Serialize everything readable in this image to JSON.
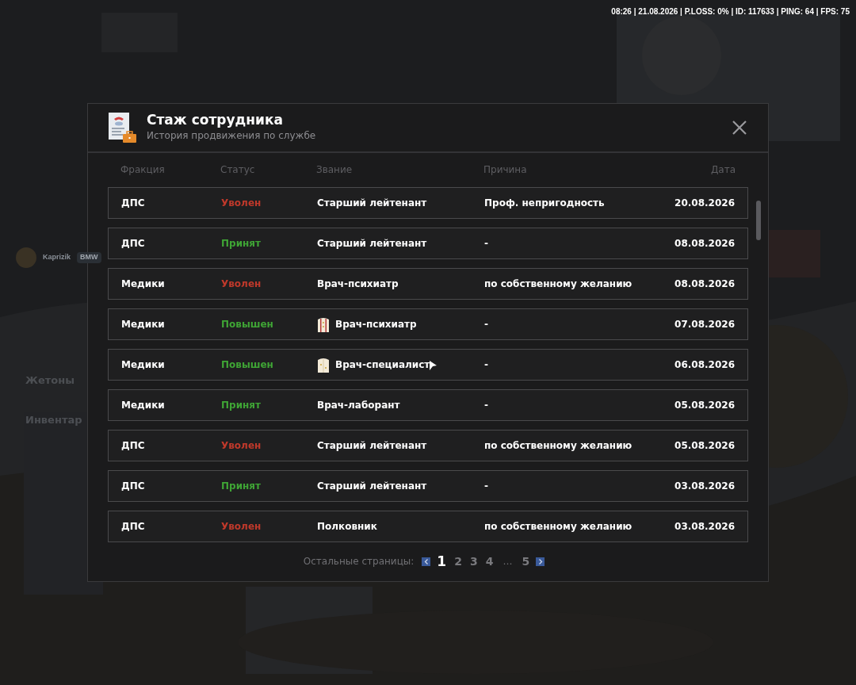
{
  "status_bar": {
    "text": "08:26 | 21.08.2026 | P.LOSS: 0% | ID: 117633 | PING: 64 | FPS: 75"
  },
  "background_hud": {
    "player": "Kaprizik",
    "vehicle": "BMW",
    "menu": [
      "Жетоны",
      "Инвентар"
    ]
  },
  "dialog": {
    "title": "Стаж сотрудника",
    "subtitle": "История продвижения по службе",
    "columns": [
      "Фракция",
      "Статус",
      "Звание",
      "Причина",
      "Дата"
    ],
    "rows": [
      {
        "faction": "ДПС",
        "status": {
          "text": "Уволен",
          "kind": "fired"
        },
        "rank": "Старший лейтенант",
        "reason": "Проф. непригодность",
        "date": "20.08.2026"
      },
      {
        "faction": "ДПС",
        "status": {
          "text": "Принят",
          "kind": "hired"
        },
        "rank": "Старший лейтенант",
        "reason": "-",
        "date": "08.08.2026"
      },
      {
        "faction": "Медики",
        "status": {
          "text": "Уволен",
          "kind": "fired"
        },
        "rank": "Врач-психиатр",
        "reason": "по собственному желанию",
        "date": "08.08.2026"
      },
      {
        "faction": "Медики",
        "status": {
          "text": "Повышен",
          "kind": "promoted"
        },
        "rank": "Врач-психиатр",
        "rank_icon": {
          "kind": "striped"
        },
        "reason": "-",
        "date": "07.08.2026"
      },
      {
        "faction": "Медики",
        "status": {
          "text": "Повышен",
          "kind": "promoted"
        },
        "rank": "Врач-специалист",
        "rank_icon": {
          "kind": "plain"
        },
        "reason": "-",
        "date": "06.08.2026"
      },
      {
        "faction": "Медики",
        "status": {
          "text": "Принят",
          "kind": "hired"
        },
        "rank": "Врач-лаборант",
        "reason": "-",
        "date": "05.08.2026"
      },
      {
        "faction": "ДПС",
        "status": {
          "text": "Уволен",
          "kind": "fired"
        },
        "rank": "Старший лейтенант",
        "reason": "по собственному желанию",
        "date": "05.08.2026"
      },
      {
        "faction": "ДПС",
        "status": {
          "text": "Принят",
          "kind": "hired"
        },
        "rank": "Старший лейтенант",
        "reason": "-",
        "date": "03.08.2026"
      },
      {
        "faction": "ДПС",
        "status": {
          "text": "Уволен",
          "kind": "fired"
        },
        "rank": "Полковник",
        "reason": "по собственному желанию",
        "date": "03.08.2026"
      }
    ],
    "pagination": {
      "label": "Остальные страницы:",
      "pages": [
        {
          "text": "1",
          "selected": true
        },
        {
          "text": "2",
          "selected": false
        },
        {
          "text": "3",
          "selected": false
        },
        {
          "text": "4",
          "selected": false
        },
        {
          "text": "…",
          "kind": "gap"
        },
        {
          "text": "5",
          "selected": false
        }
      ]
    }
  }
}
